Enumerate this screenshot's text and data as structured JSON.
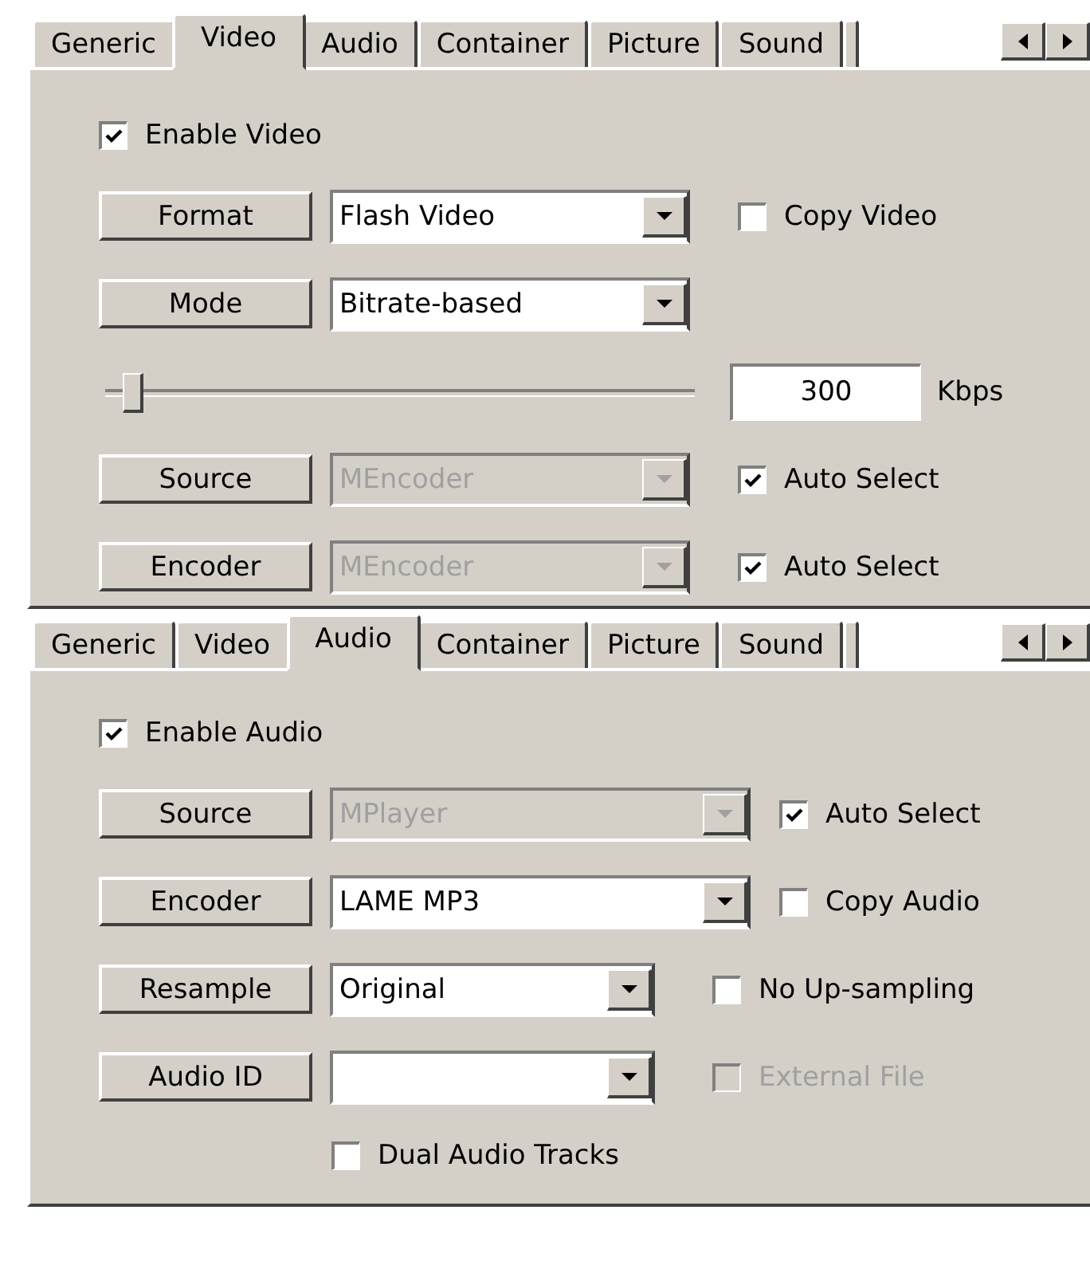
{
  "panels": [
    {
      "tabs": [
        {
          "label": "Generic",
          "selected": false
        },
        {
          "label": "Video",
          "selected": true
        },
        {
          "label": "Audio",
          "selected": false
        },
        {
          "label": "Container",
          "selected": false
        },
        {
          "label": "Picture",
          "selected": false
        },
        {
          "label": "Sound",
          "selected": false
        }
      ],
      "enable": {
        "label": "Enable Video",
        "checked": true
      },
      "rows": [
        {
          "kind": "control",
          "button": "Format",
          "combo": {
            "value": "Flash Video",
            "disabled": false
          },
          "checkbox": {
            "label": "Copy Video",
            "checked": false,
            "disabled": false
          }
        },
        {
          "kind": "control",
          "button": "Mode",
          "combo": {
            "value": "Bitrate-based",
            "disabled": false
          }
        },
        {
          "kind": "slider",
          "level": 0.03,
          "value": "300",
          "unit": "Kbps"
        },
        {
          "kind": "control",
          "button": "Source",
          "combo": {
            "value": "MEncoder",
            "disabled": true
          },
          "checkbox": {
            "label": "Auto Select",
            "checked": true,
            "disabled": false
          }
        },
        {
          "kind": "control",
          "button": "Encoder",
          "combo": {
            "value": "MEncoder",
            "disabled": true
          },
          "checkbox": {
            "label": "Auto Select",
            "checked": true,
            "disabled": false
          }
        }
      ]
    },
    {
      "tabs": [
        {
          "label": "Generic",
          "selected": false
        },
        {
          "label": "Video",
          "selected": false
        },
        {
          "label": "Audio",
          "selected": true
        },
        {
          "label": "Container",
          "selected": false
        },
        {
          "label": "Picture",
          "selected": false
        },
        {
          "label": "Sound",
          "selected": false
        }
      ],
      "enable": {
        "label": "Enable Audio",
        "checked": true
      },
      "rows": [
        {
          "kind": "control",
          "button": "Source",
          "combo": {
            "value": "MPlayer",
            "disabled": true
          },
          "checkbox": {
            "label": "Auto Select",
            "checked": true,
            "disabled": false
          }
        },
        {
          "kind": "control",
          "button": "Encoder",
          "combo": {
            "value": "LAME MP3",
            "disabled": false
          },
          "checkbox": {
            "label": "Copy Audio",
            "checked": false,
            "disabled": false
          }
        },
        {
          "kind": "control",
          "button": "Resample",
          "combo": {
            "value": "Original",
            "disabled": false
          },
          "checkbox": {
            "label": "No Up-sampling",
            "checked": false,
            "disabled": false
          }
        },
        {
          "kind": "control",
          "button": "Audio ID",
          "combo": {
            "disabled": false
          },
          "checkbox": {
            "label": "External File",
            "checked": false,
            "disabled": true
          }
        },
        {
          "kind": "check",
          "checkbox": {
            "label": "Dual Audio Tracks",
            "checked": false,
            "disabled": false
          }
        }
      ]
    }
  ]
}
